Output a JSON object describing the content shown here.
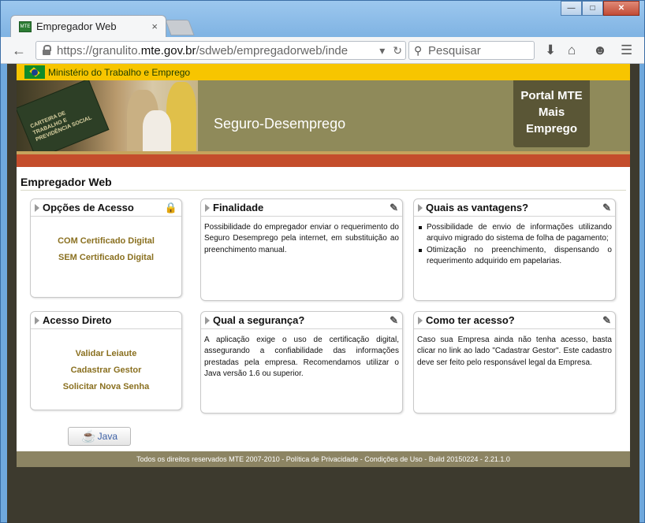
{
  "browser": {
    "tab_title": "Empregador Web",
    "tab_favicon": "MTE",
    "url_prefix": "https://granulito.",
    "url_host": "mte.gov.br",
    "url_path": "/sdweb/empregadorweb/inde",
    "search_placeholder": "Pesquisar",
    "window_controls": [
      "minimize-icon",
      "maximize-icon",
      "close-icon"
    ]
  },
  "gov_bar": {
    "label": "Ministério do Trabalho e Emprego"
  },
  "hero": {
    "card_text": "CARTEIRA DE TRABALHO E PREVIDÊNCIA SOCIAL",
    "title": "Seguro-Desemprego",
    "portal_lines": [
      "Portal MTE",
      "Mais",
      "Emprego"
    ]
  },
  "section": {
    "title": "Empregador Web"
  },
  "boxes": {
    "opcoes": {
      "title": "Opções de Acesso",
      "links": [
        "COM Certificado Digital",
        "SEM Certificado Digital"
      ]
    },
    "finalidade": {
      "title": "Finalidade",
      "text": "Possibilidade do empregador enviar o requerimento do Seguro Desemprego pela internet, em substituição ao preenchimento manual."
    },
    "vantagens": {
      "title": "Quais as vantagens?",
      "items": [
        "Possibilidade de envio de informações utilizando arquivo migrado do sistema de folha de pagamento;",
        "Otimização no preenchimento, dispensando o requerimento adquirido em papelarias."
      ]
    },
    "acesso_direto": {
      "title": "Acesso Direto",
      "links": [
        "Validar Leiaute",
        "Cadastrar Gestor",
        "Solicitar Nova Senha"
      ]
    },
    "seguranca": {
      "title": "Qual a segurança?",
      "text": "A aplicação exige o uso de certificação digital, assegurando a confiabilidade das informações prestadas pela empresa. Recomendamos utilizar o Java versão 1.6 ou superior."
    },
    "como_acesso": {
      "title": "Como ter acesso?",
      "text": "Caso sua Empresa ainda não tenha acesso, basta clicar no link ao lado \"Cadastrar Gestor\". Este cadastro deve ser feito pelo responsável legal da Empresa."
    }
  },
  "java_button": {
    "label": "Java"
  },
  "footer": {
    "text": "Todos os direitos reservados MTE 2007-2010 - Política de Privacidade - Condições de Uso - Build 20150224 - 2.21.1.0"
  }
}
